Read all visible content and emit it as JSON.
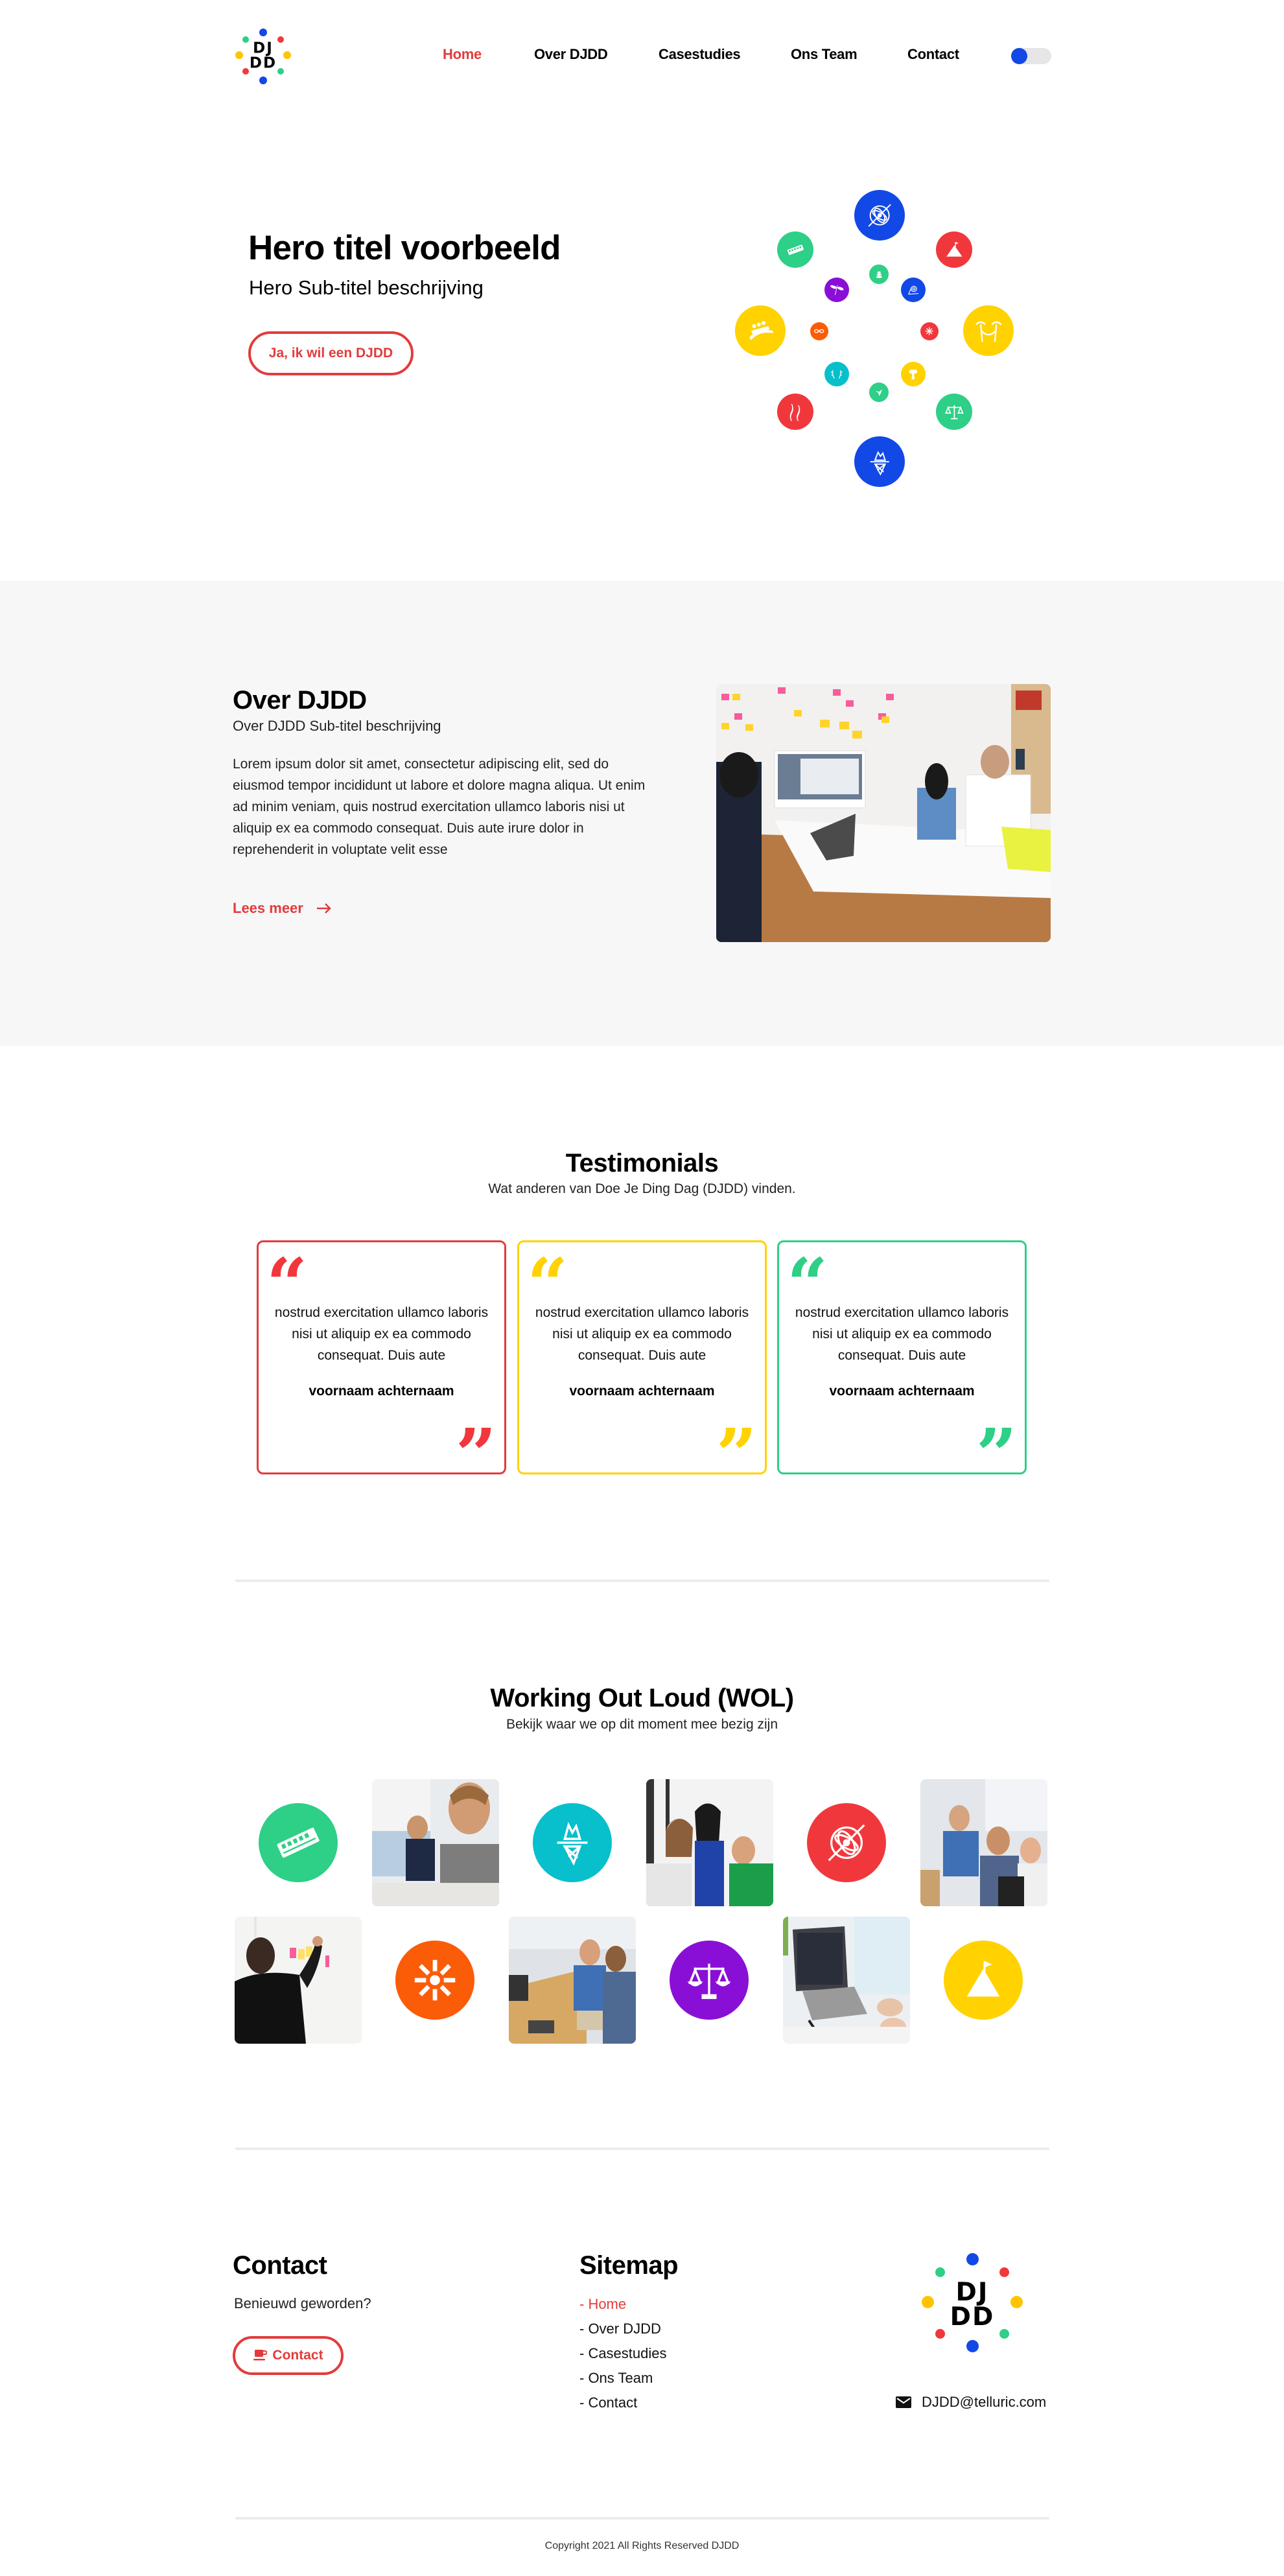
{
  "colors": {
    "brand_red": "#e33b3b",
    "brand_blue": "#1248e6",
    "brand_green": "#2ecf86",
    "brand_yellow": "#ffd200",
    "brand_purple": "#8a0fd6",
    "brand_orange": "#fb5c07",
    "brand_teal": "#08bfcc",
    "section_grey": "#f7f7f7"
  },
  "header": {
    "logo_text_line1": "DJ",
    "logo_text_line2": "DD",
    "nav": [
      {
        "label": "Home",
        "active": true
      },
      {
        "label": "Over DJDD",
        "active": false
      },
      {
        "label": "Casestudies",
        "active": false
      },
      {
        "label": "Ons Team",
        "active": false
      },
      {
        "label": "Contact",
        "active": false
      }
    ],
    "theme_toggle": {
      "state": "off"
    }
  },
  "hero": {
    "title": "Hero titel voorbeeld",
    "subtitle": "Hero Sub-titel beschrijving",
    "cta_label": "Ja, ik wil een DJDD",
    "icons": [
      {
        "name": "atom-icon",
        "color": "blue",
        "size": "large"
      },
      {
        "name": "mountain-flag-icon",
        "color": "red",
        "size": "medium"
      },
      {
        "name": "hammock-palm-icon",
        "color": "yellow",
        "size": "large"
      },
      {
        "name": "scales-icon",
        "color": "green",
        "size": "medium"
      },
      {
        "name": "iceberg-icon",
        "color": "blue",
        "size": "large"
      },
      {
        "name": "koi-fish-icon",
        "color": "red",
        "size": "medium"
      },
      {
        "name": "rollercoaster-icon",
        "color": "yellow",
        "size": "large"
      },
      {
        "name": "harmonica-icon",
        "color": "green",
        "size": "medium"
      },
      {
        "name": "stones-icon",
        "color": "green",
        "size": "small"
      },
      {
        "name": "gear-pulley-icon",
        "color": "blue",
        "size": "small"
      },
      {
        "name": "asterisk-flower-icon",
        "color": "red",
        "size": "tiny"
      },
      {
        "name": "tree-icon",
        "color": "yellow",
        "size": "small"
      },
      {
        "name": "bird-icon",
        "color": "green",
        "size": "small"
      },
      {
        "name": "antlers-icon",
        "color": "teal",
        "size": "small"
      },
      {
        "name": "chain-icon",
        "color": "orange",
        "size": "tiny"
      },
      {
        "name": "dragonfly-icon",
        "color": "purple",
        "size": "small"
      }
    ]
  },
  "over": {
    "title": "Over DJDD",
    "subtitle": "Over DJDD Sub-titel beschrijving",
    "body": "Lorem ipsum dolor sit amet, consectetur adipiscing elit, sed do eiusmod tempor incididunt ut labore et dolore magna aliqua. Ut enim ad minim veniam, quis nostrud exercitation ullamco laboris nisi ut aliquip ex ea commodo consequat. Duis aute irure dolor in reprehenderit in voluptate velit esse",
    "link_label": "Lees meer",
    "image_alt": "team-meeting-photo"
  },
  "testimonials": {
    "title": "Testimonials",
    "subtitle": "Wat anderen van Doe Je Ding Dag (DJDD) vinden.",
    "items": [
      {
        "quote": "nostrud exercitation ullamco laboris nisi ut aliquip ex ea commodo consequat. Duis aute",
        "name": "voornaam achternaam",
        "color": "#e33b3b"
      },
      {
        "quote": "nostrud exercitation ullamco laboris nisi ut aliquip ex ea commodo consequat. Duis aute",
        "name": "voornaam achternaam",
        "color": "#ffd200"
      },
      {
        "quote": "nostrud exercitation ullamco laboris nisi ut aliquip ex ea commodo consequat. Duis aute",
        "name": "voornaam achternaam",
        "color": "#2ecf86"
      }
    ],
    "open_quote": "“",
    "close_quote": "”"
  },
  "wol": {
    "title": "Working Out Loud (WOL)",
    "subtitle": "Bekijk waar we op dit moment mee bezig zijn",
    "row1": [
      {
        "type": "icon",
        "name": "harmonica-icon",
        "color": "#2ecf86"
      },
      {
        "type": "photo",
        "name": "developers-at-desk-photo"
      },
      {
        "type": "icon",
        "name": "iceberg-icon",
        "color": "#08bfcc"
      },
      {
        "type": "photo",
        "name": "team-at-laptop-photo"
      },
      {
        "type": "icon",
        "name": "atom-icon",
        "color": "#f0383c"
      },
      {
        "type": "photo",
        "name": "office-discussion-photo"
      }
    ],
    "row2": [
      {
        "type": "photo",
        "name": "sticky-notes-wall-photo"
      },
      {
        "type": "icon",
        "name": "asterisk-flower-icon",
        "color": "#fb5c07"
      },
      {
        "type": "photo",
        "name": "office-chat-photo"
      },
      {
        "type": "icon",
        "name": "scales-icon",
        "color": "#8a0fd6"
      },
      {
        "type": "photo",
        "name": "laptop-stand-coding-photo"
      },
      {
        "type": "icon",
        "name": "mountain-flag-icon",
        "color": "#ffd200"
      }
    ]
  },
  "footer": {
    "contact_title": "Contact",
    "contact_text": "Benieuwd geworden?",
    "contact_button": "Contact",
    "sitemap_title": "Sitemap",
    "sitemap": [
      {
        "label": "- Home",
        "active": true
      },
      {
        "label": "- Over DJDD",
        "active": false
      },
      {
        "label": "- Casestudies",
        "active": false
      },
      {
        "label": "- Ons Team",
        "active": false
      },
      {
        "label": "- Contact",
        "active": false
      }
    ],
    "logo_text_line1": "DJ",
    "logo_text_line2": "DD",
    "email": "DJDD@telluric.com",
    "copyright": "Copyright 2021 All Rights Reserved DJDD"
  }
}
